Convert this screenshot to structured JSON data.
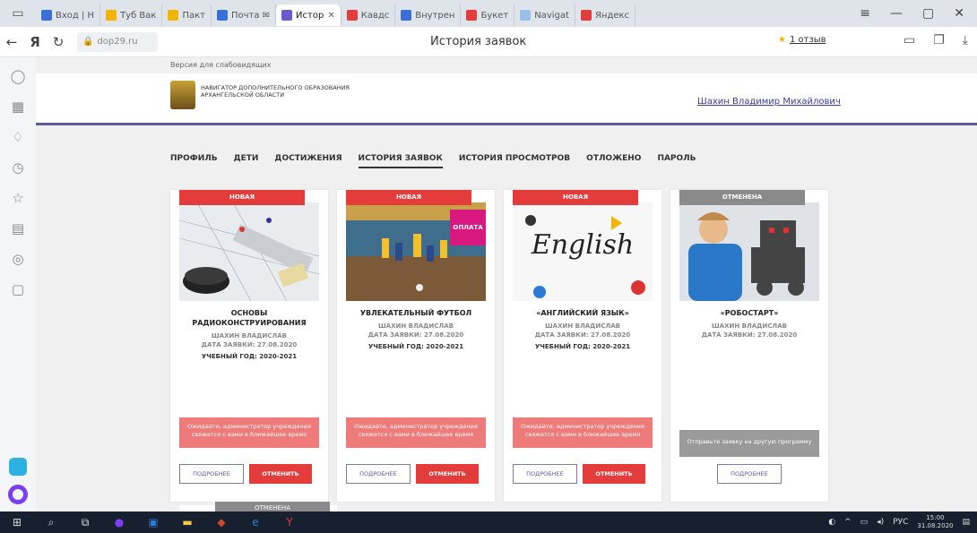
{
  "browser": {
    "tabs": [
      {
        "label": "Вход | Н",
        "color": "#3a6fd8"
      },
      {
        "label": "Туб Вак",
        "color": "#f2b600"
      },
      {
        "label": "Пакт",
        "color": "#f2b600"
      },
      {
        "label": "Почта ✉",
        "color": "#3a6fd8"
      },
      {
        "label": "Истор",
        "color": "#6a5acd",
        "active": true
      },
      {
        "label": "Кавдс",
        "color": "#e43b3b"
      },
      {
        "label": "Внутрен",
        "color": "#3a6fd8"
      },
      {
        "label": "Букет",
        "color": "#e43b3b"
      },
      {
        "label": "Navigat",
        "color": "#9bbfe8"
      },
      {
        "label": "Яндекс",
        "color": "#e43b3b"
      }
    ],
    "url": "dop29.ru",
    "page_title": "История заявок",
    "reviews_label": "1 отзыв",
    "window_controls": [
      "≡",
      "—",
      "▢",
      "✕"
    ]
  },
  "site": {
    "visually_impaired_link": "Версия для слабовидящих",
    "logo_text": "Навигатор дополнительного образования Архангельской области",
    "username": "Шахин Владимир Михайлович",
    "nav": [
      {
        "label": "Профиль",
        "active": false
      },
      {
        "label": "Дети",
        "active": false
      },
      {
        "label": "Достижения",
        "active": false
      },
      {
        "label": "История заявок",
        "active": true
      },
      {
        "label": "История просмотров",
        "active": false
      },
      {
        "label": "Отложено",
        "active": false
      },
      {
        "label": "Пароль",
        "active": false
      }
    ]
  },
  "cards": [
    {
      "status": "Новая",
      "status_type": "new",
      "title": "Основы радиоконструирования",
      "child": "Шахин Владислав",
      "date": "Дата заявки: 27.08.2020",
      "year": "Учебный год: 2020-2021",
      "info": "Ожидайте, администратор учреждения свяжется с вами в ближайшее время",
      "btn_details": "Подробнее",
      "btn_cancel": "Отменить",
      "image": "radio"
    },
    {
      "status": "Новая",
      "status_type": "new",
      "title": "Увлекательный футбол",
      "child": "Шахин Владислав",
      "date": "Дата заявки: 27.08.2020",
      "year": "Учебный год: 2020-2021",
      "info": "Ожидайте, администратор учреждения свяжется с вами в ближайшее время",
      "btn_details": "Подробнее",
      "btn_cancel": "Отменить",
      "image": "football",
      "sticker": "Оплата"
    },
    {
      "status": "Новая",
      "status_type": "new",
      "title": "«Английский язык»",
      "child": "Шахин Владислав",
      "date": "Дата заявки: 27.08.2020",
      "year": "Учебный год: 2020-2021",
      "info": "Ожидайте, администратор учреждения свяжется с вами в ближайшее время",
      "btn_details": "Подробнее",
      "btn_cancel": "Отменить",
      "image": "english",
      "image_text": "English"
    },
    {
      "status": "Отменена",
      "status_type": "cancel",
      "title": "«Робостарт»",
      "child": "Шахин Владислав",
      "date": "Дата заявки: 27.08.2020",
      "year": "",
      "info": "Отправьте заявку на другую программу",
      "btn_details": "Подробнее",
      "image": "robot"
    }
  ],
  "peek_status": "Отменена",
  "taskbar": {
    "lang": "РУС",
    "time": "15:00",
    "date": "31.08.2020"
  }
}
